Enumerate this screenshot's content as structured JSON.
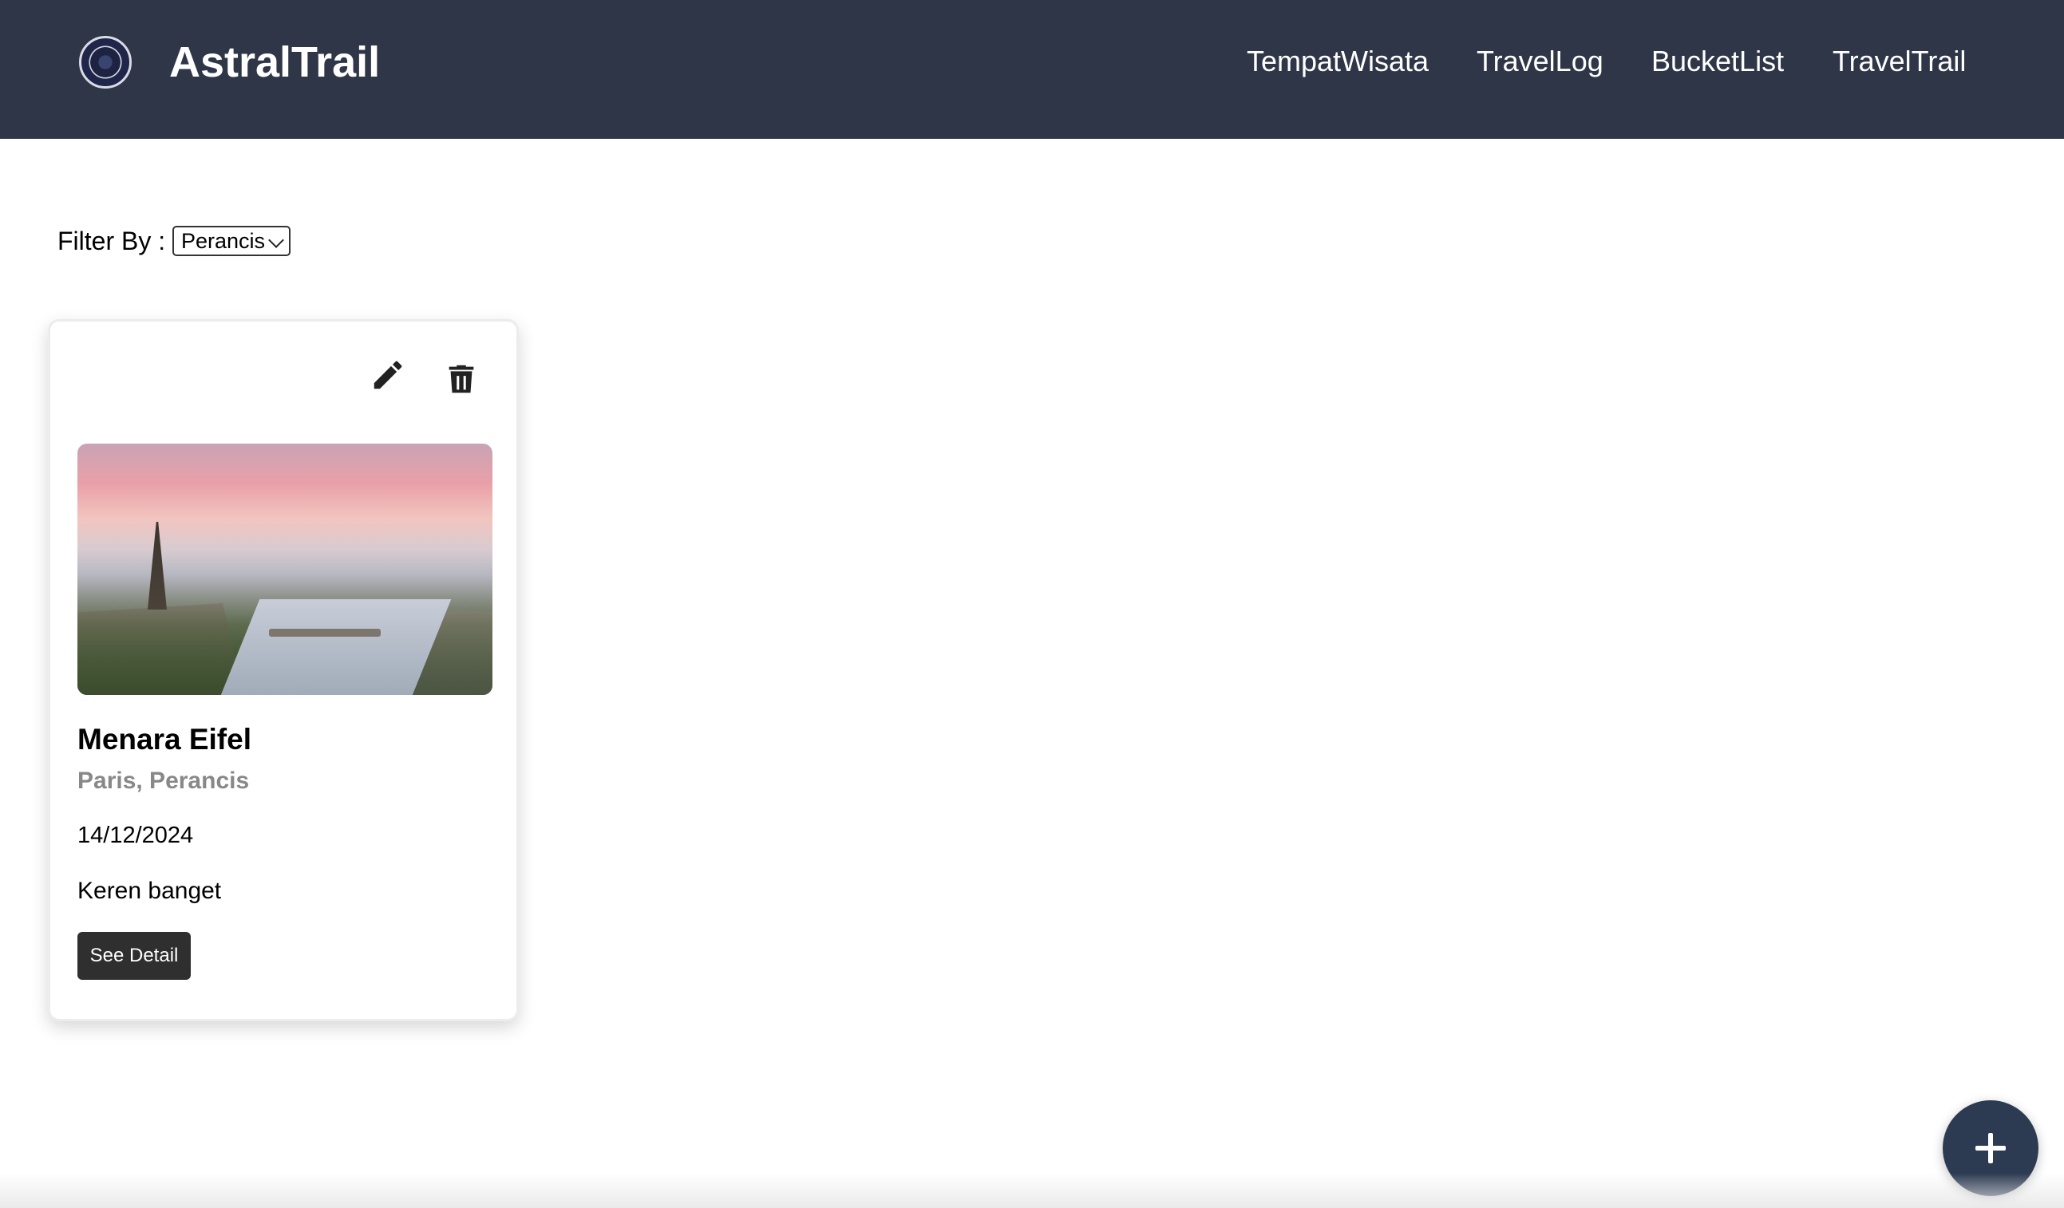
{
  "navbar": {
    "brand": "AstralTrail",
    "logo_icon": "astraltrail-logo-icon",
    "links": [
      "TempatWisata",
      "TravelLog",
      "BucketList",
      "TravelTrail"
    ],
    "background": "#2f3647"
  },
  "filter": {
    "label": "Filter By :",
    "selected": "Perancis"
  },
  "cards": [
    {
      "title": "Menara Eifel",
      "location": "Paris, Perancis",
      "date": "14/12/2024",
      "description": "Keren banget",
      "button_label": "See Detail",
      "icons": [
        "pencil-icon",
        "trash-icon"
      ]
    }
  ],
  "fab": {
    "icon": "plus-icon",
    "color": "#2c3a52"
  }
}
